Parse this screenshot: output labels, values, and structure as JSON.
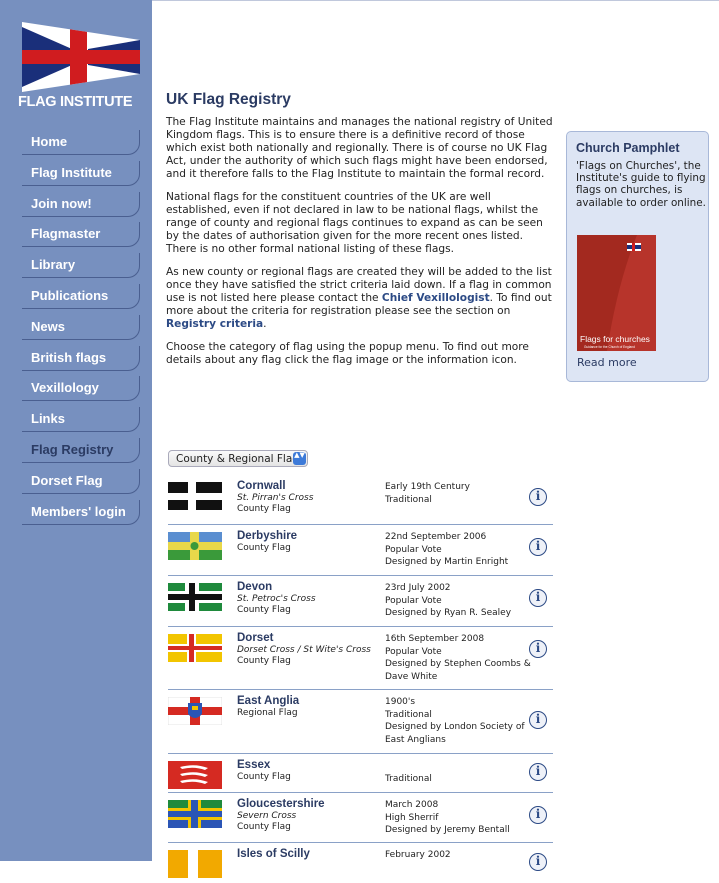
{
  "brand": {
    "logo_text": "FLAG INSTITUTE"
  },
  "nav": [
    {
      "label": "Home"
    },
    {
      "label": "Flag Institute"
    },
    {
      "label": "Join now!"
    },
    {
      "label": "Flagmaster"
    },
    {
      "label": "Library"
    },
    {
      "label": "Publications"
    },
    {
      "label": "News"
    },
    {
      "label": "British flags"
    },
    {
      "label": "Vexillology"
    },
    {
      "label": "Links"
    },
    {
      "label": "Flag Registry",
      "active": true
    },
    {
      "label": "Dorset Flag"
    },
    {
      "label": "Members' login"
    }
  ],
  "main": {
    "title": "UK Flag Registry",
    "p1": "The Flag Institute maintains and manages the national registry of United Kingdom flags. This is to ensure there is a definitive record of those which exist both nationally and regionally. There is of course no UK Flag Act, under the authority of which such flags might have been endorsed, and it therefore falls to the Flag Institute to maintain the formal record.",
    "p2": "National flags for the constituent countries of the UK are well established, even if not declared in law to be national flags, whilst the range of county and regional flags continues to expand as can be seen by the dates of authorisation given for the more recent ones listed. There is no other formal national listing of these flags.",
    "p3_a": "As new county or regional flags are created they will be added to the list once they have satisfied the strict criteria laid down. If a flag in common use is not listed here please contact the ",
    "p3_link1": "Chief Vexillologist",
    "p3_b": ". To find out more about the criteria for registration please see the section on ",
    "p3_link2": "Registry criteria",
    "p3_c": ".",
    "p4": "Choose the category of flag using the popup menu. To find out more details about any flag click the flag image or the information icon.",
    "select_value": "County & Regional Flags",
    "select_arrows": "▲▼",
    "info_glyph": "i"
  },
  "flags": [
    {
      "name": "Cornwall",
      "alt": "St. Pirran's Cross",
      "type": "County Flag",
      "details": [
        "Early 19th Century",
        "Traditional"
      ],
      "flag_icon": "cornwall-flag"
    },
    {
      "name": "Derbyshire",
      "alt": "",
      "type": "County Flag",
      "details": [
        "22nd September 2006",
        "Popular Vote",
        "Designed by Martin Enright"
      ],
      "flag_icon": "derbyshire-flag"
    },
    {
      "name": "Devon",
      "alt": "St. Petroc's Cross",
      "type": "County Flag",
      "details": [
        "23rd July 2002",
        "Popular Vote",
        "Designed by Ryan R. Sealey"
      ],
      "flag_icon": "devon-flag"
    },
    {
      "name": "Dorset",
      "alt": "Dorset Cross / St Wite's Cross",
      "type": "County Flag",
      "details": [
        "16th September 2008",
        "Popular Vote",
        "Designed by Stephen Coombs &",
        "Dave White"
      ],
      "flag_icon": "dorset-flag"
    },
    {
      "name": "East Anglia",
      "alt": "",
      "type": "Regional Flag",
      "details": [
        "1900's",
        "Traditional",
        "Designed by London Society of",
        "East Anglians"
      ],
      "flag_icon": "east-anglia-flag"
    },
    {
      "name": "Essex",
      "alt": "",
      "type": "County Flag",
      "details": [
        "",
        "Traditional"
      ],
      "flag_icon": "essex-flag"
    },
    {
      "name": "Gloucestershire",
      "alt": "Severn Cross",
      "type": "County Flag",
      "details": [
        "March 2008",
        "High Sherrif",
        "Designed by Jeremy Bentall"
      ],
      "flag_icon": "gloucestershire-flag"
    },
    {
      "name": "Isles of Scilly",
      "alt": "",
      "type": "",
      "details": [
        "February 2002"
      ],
      "flag_icon": "isles-of-scilly-flag"
    }
  ],
  "pamphlet": {
    "title": "Church Pamphlet",
    "description": "'Flags on Churches', the Institute's guide to flying flags on churches, is available to order online.",
    "cover_title": "Flags for churches",
    "cover_subtitle": "Guidance for the Church of England",
    "read_more": "Read more"
  }
}
